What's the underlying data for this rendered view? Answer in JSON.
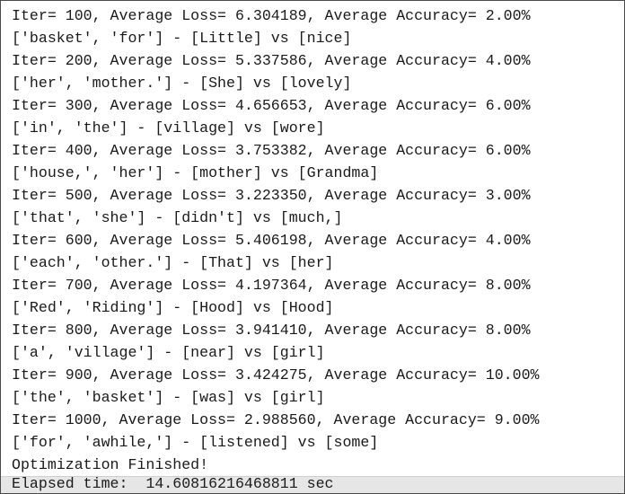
{
  "console": {
    "lines": [
      "Iter= 100, Average Loss= 6.304189, Average Accuracy= 2.00%",
      "['basket', 'for'] - [Little] vs [nice]",
      "Iter= 200, Average Loss= 5.337586, Average Accuracy= 4.00%",
      "['her', 'mother.'] - [She] vs [lovely]",
      "Iter= 300, Average Loss= 4.656653, Average Accuracy= 6.00%",
      "['in', 'the'] - [village] vs [wore]",
      "Iter= 400, Average Loss= 3.753382, Average Accuracy= 6.00%",
      "['house,', 'her'] - [mother] vs [Grandma]",
      "Iter= 500, Average Loss= 3.223350, Average Accuracy= 3.00%",
      "['that', 'she'] - [didn't] vs [much,]",
      "Iter= 600, Average Loss= 5.406198, Average Accuracy= 4.00%",
      "['each', 'other.'] - [That] vs [her]",
      "Iter= 700, Average Loss= 4.197364, Average Accuracy= 8.00%",
      "['Red', 'Riding'] - [Hood] vs [Hood]",
      "Iter= 800, Average Loss= 3.941410, Average Accuracy= 8.00%",
      "['a', 'village'] - [near] vs [girl]",
      "Iter= 900, Average Loss= 3.424275, Average Accuracy= 10.00%",
      "['the', 'basket'] - [was] vs [girl]",
      "Iter= 1000, Average Loss= 2.988560, Average Accuracy= 9.00%",
      "['for', 'awhile,'] - [listened] vs [some]",
      "Optimization Finished!"
    ],
    "elapsed_line": "Elapsed time:  14.60816216468811 sec"
  }
}
